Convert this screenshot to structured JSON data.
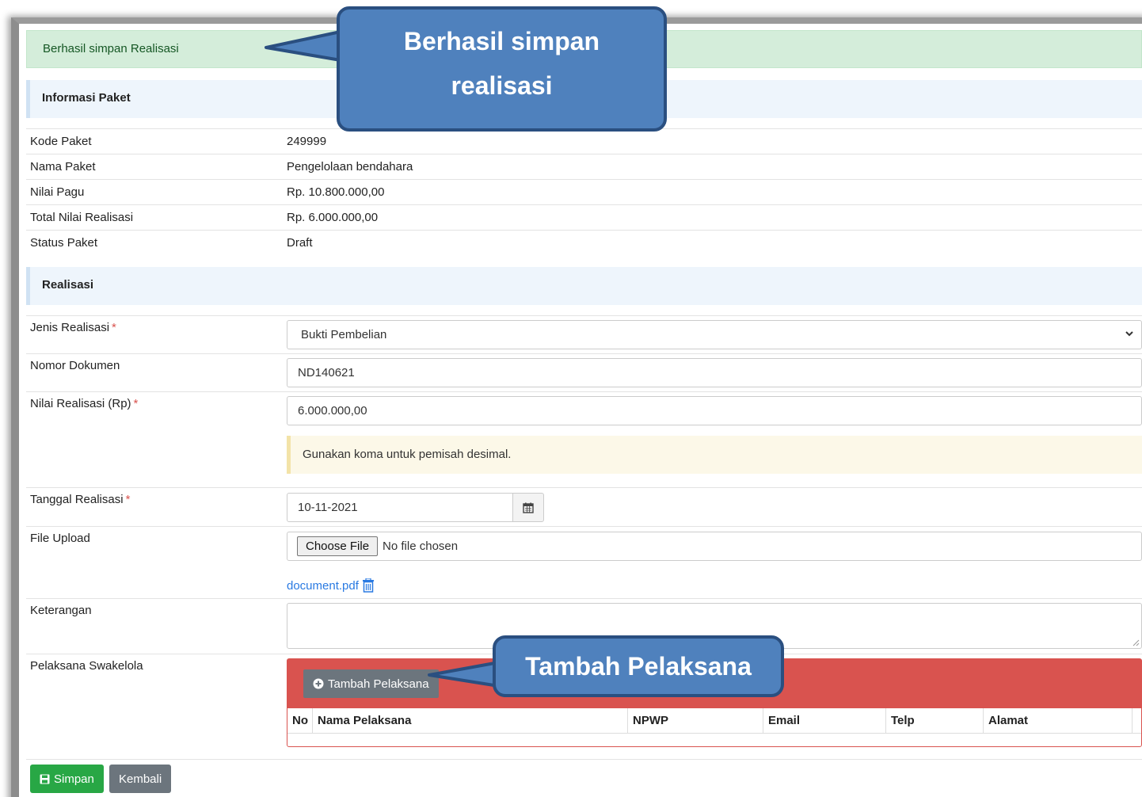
{
  "alert": {
    "message": "Berhasil simpan Realisasi"
  },
  "informasi_paket": {
    "title": "Informasi Paket",
    "rows": [
      {
        "label": "Kode Paket",
        "value": "249999"
      },
      {
        "label": "Nama Paket",
        "value": "Pengelolaan bendahara"
      },
      {
        "label": "Nilai Pagu",
        "value": "Rp. 10.800.000,00"
      },
      {
        "label": "Total Nilai Realisasi",
        "value": "Rp. 6.000.000,00"
      },
      {
        "label": "Status Paket",
        "value": "Draft"
      }
    ]
  },
  "realisasi": {
    "title": "Realisasi",
    "required_mark": "*",
    "jenis_label": "Jenis Realisasi",
    "jenis_value": "Bukti Pembelian",
    "nomor_label": "Nomor Dokumen",
    "nomor_value": "ND140621",
    "nilai_label": "Nilai Realisasi (Rp)",
    "nilai_value": "6.000.000,00",
    "nilai_help": "Gunakan koma untuk pemisah desimal.",
    "tanggal_label": "Tanggal Realisasi",
    "tanggal_value": "10-11-2021",
    "file_label": "File Upload",
    "choose_file": "Choose File",
    "no_file": "No file chosen",
    "file_link": "document.pdf",
    "keterangan_label": "Keterangan",
    "keterangan_value": "",
    "pelaksana_label": "Pelaksana Swakelola",
    "tambah_button": "Tambah Pelaksana",
    "table_headers": [
      "No",
      "Nama Pelaksana",
      "NPWP",
      "Email",
      "Telp",
      "Alamat"
    ]
  },
  "actions": {
    "simpan": "Simpan",
    "kembali": "Kembali"
  },
  "callouts": {
    "top_line1": "Berhasil simpan",
    "top_line2": "realisasi",
    "bottom": "Tambah Pelaksana"
  },
  "colors": {
    "success_bg": "#d4edda",
    "danger": "#d9534f",
    "primary_green": "#28a745",
    "secondary": "#6c757d",
    "callout_blue": "#4f81bd"
  },
  "icons": [
    "calendar-icon",
    "trash-icon",
    "plus-circle-icon",
    "save-icon",
    "chevron-down-icon"
  ]
}
